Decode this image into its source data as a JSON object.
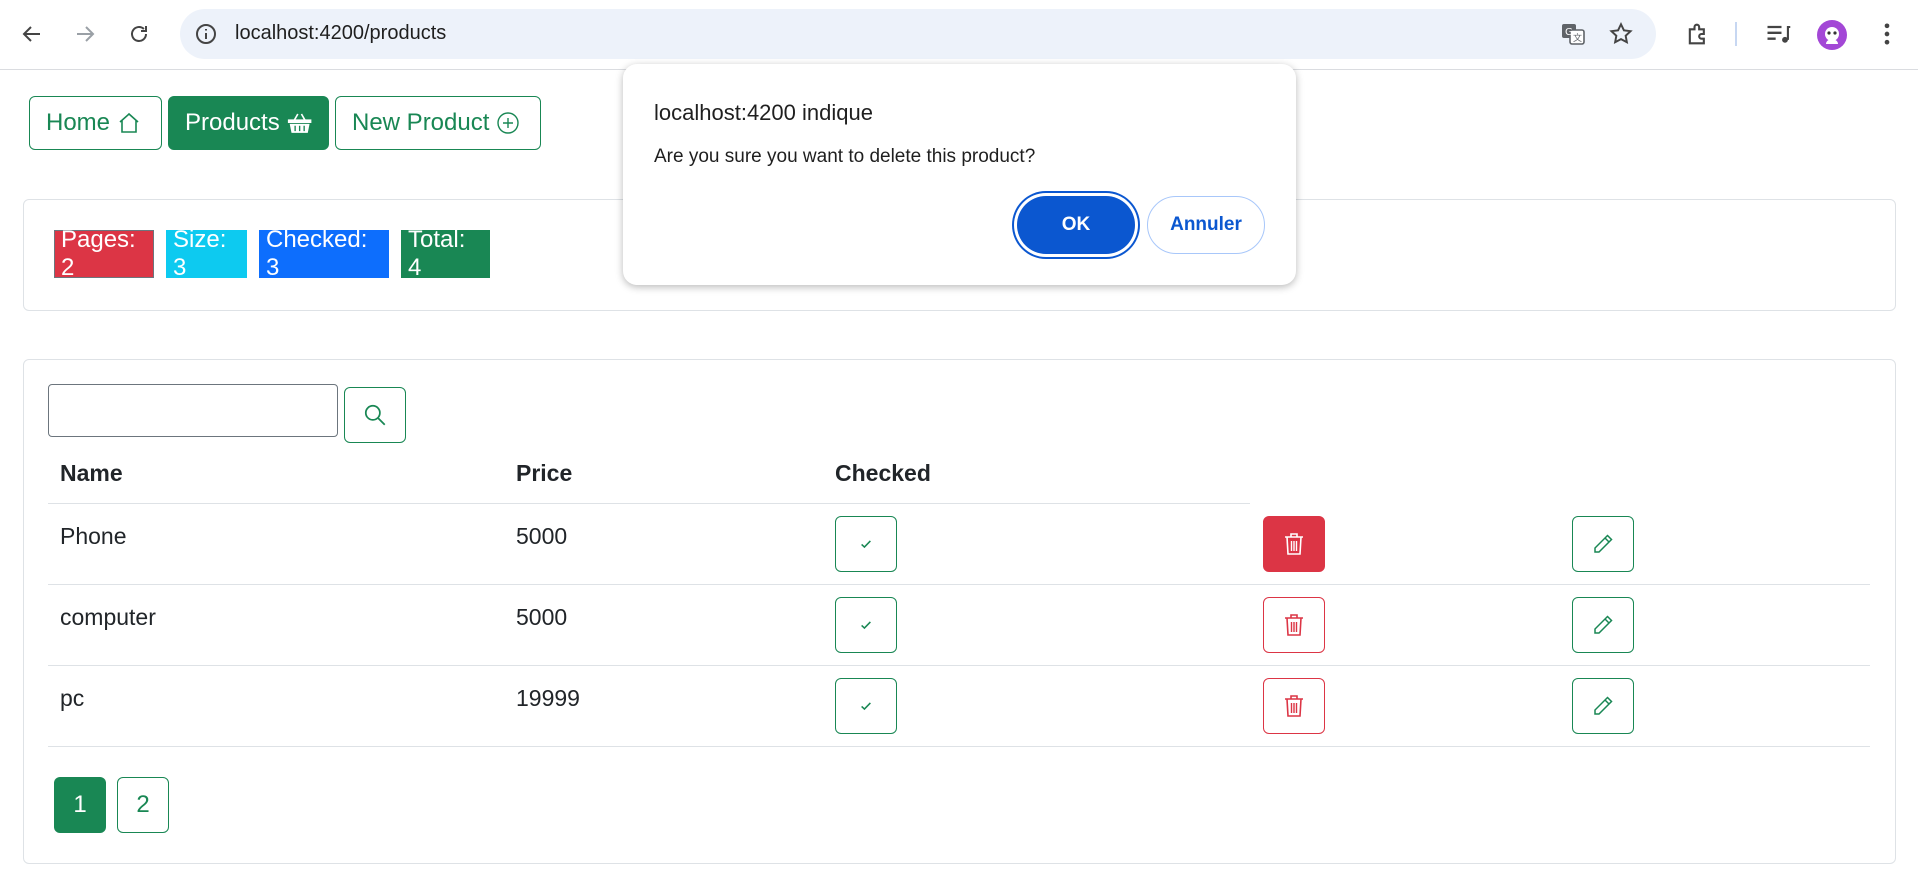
{
  "browser": {
    "url": "localhost:4200/products",
    "icons": [
      "back-icon",
      "forward-icon",
      "reload-icon",
      "site-info-icon",
      "translate-icon",
      "bookmark-star-icon",
      "extensions-icon",
      "media-control-icon",
      "profile-avatar",
      "more-menu-icon"
    ]
  },
  "nav": {
    "home_label": "Home",
    "products_label": "Products",
    "new_product_label": "New Product"
  },
  "stats": {
    "pages": "Pages: 2",
    "size": "Size: 3",
    "checked": "Checked: 3",
    "total": "Total: 4"
  },
  "search": {
    "value": "",
    "placeholder": ""
  },
  "table": {
    "headers": {
      "name": "Name",
      "price": "Price",
      "checked": "Checked"
    },
    "rows": [
      {
        "name": "Phone",
        "price": "5000",
        "checked": true
      },
      {
        "name": "computer",
        "price": "5000",
        "checked": true
      },
      {
        "name": "pc",
        "price": "19999",
        "checked": true
      }
    ]
  },
  "pagination": {
    "pages": [
      "1",
      "2"
    ],
    "current": "1"
  },
  "dialog": {
    "title": "localhost:4200 indique",
    "message": "Are you sure you want to delete this product?",
    "ok_label": "OK",
    "cancel_label": "Annuler"
  },
  "colors": {
    "success": "#198754",
    "danger": "#dc3545",
    "info": "#0dcaf0",
    "primary": "#0d6efd",
    "dialog_primary": "#0b57d0"
  }
}
